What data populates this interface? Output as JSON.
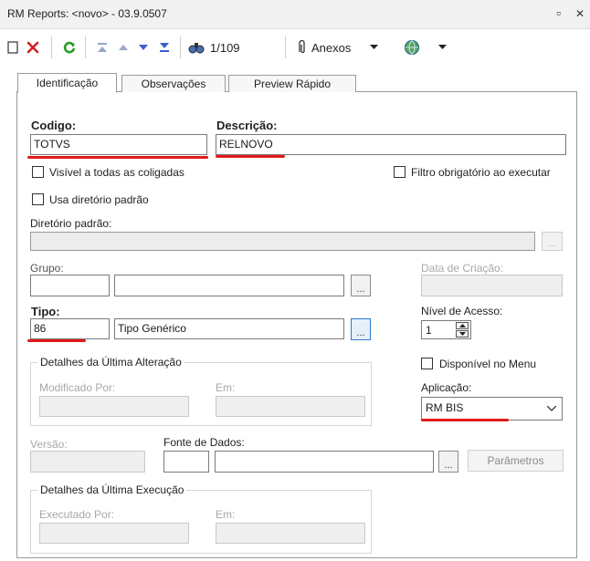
{
  "window": {
    "title": "RM Reports: <novo> - 03.9.0507",
    "restore_glyph": "▫",
    "close_glyph": "✕"
  },
  "toolbar": {
    "record_position": "1/109",
    "attachments_label": "Anexos",
    "icons": [
      "new-icon",
      "delete-icon",
      "refresh-icon",
      "first-record-icon",
      "previous-record-icon",
      "next-record-icon",
      "last-record-icon",
      "search-icon",
      "attachment-icon",
      "globe-icon"
    ]
  },
  "tabs": [
    {
      "label": "Identificação",
      "active": true
    },
    {
      "label": "Observações",
      "active": false
    },
    {
      "label": "Preview Rápido",
      "active": false
    }
  ],
  "form": {
    "codigo_label": "Codigo:",
    "codigo_value": "TOTVS",
    "descricao_label": "Descrição:",
    "descricao_value": "RELNOVO",
    "visivel_label": "Visível a todas as coligadas",
    "filtro_label": "Filtro obrigatório ao executar",
    "usa_diretorio_label": "Usa diretório padrão",
    "diretorio_label": "Diretório padrão:",
    "grupo_label": "Grupo:",
    "data_criacao_label": "Data de Criação:",
    "tipo_label": "Tipo:",
    "tipo_code": "86",
    "tipo_desc": "Tipo Genérico",
    "nivel_acesso_label": "Nível de Acesso:",
    "nivel_acesso_value": "1",
    "ultima_alteracao_title": "Detalhes da Última Alteração",
    "modificado_por_label": "Modificado Por:",
    "em_label": "Em:",
    "disponivel_menu_label": "Disponível no Menu",
    "aplicacao_label": "Aplicação:",
    "aplicacao_value": "RM BIS",
    "versao_label": "Versão:",
    "fonte_dados_label": "Fonte de Dados:",
    "parametros_label": "Parâmetros",
    "ultima_execucao_title": "Detalhes da Última Execução",
    "executado_por_label": "Executado Por:",
    "em2_label": "Em:",
    "ellipsis": "..."
  },
  "colors": {
    "highlight": "#e21a1a",
    "focus_border": "#2f78d0"
  }
}
